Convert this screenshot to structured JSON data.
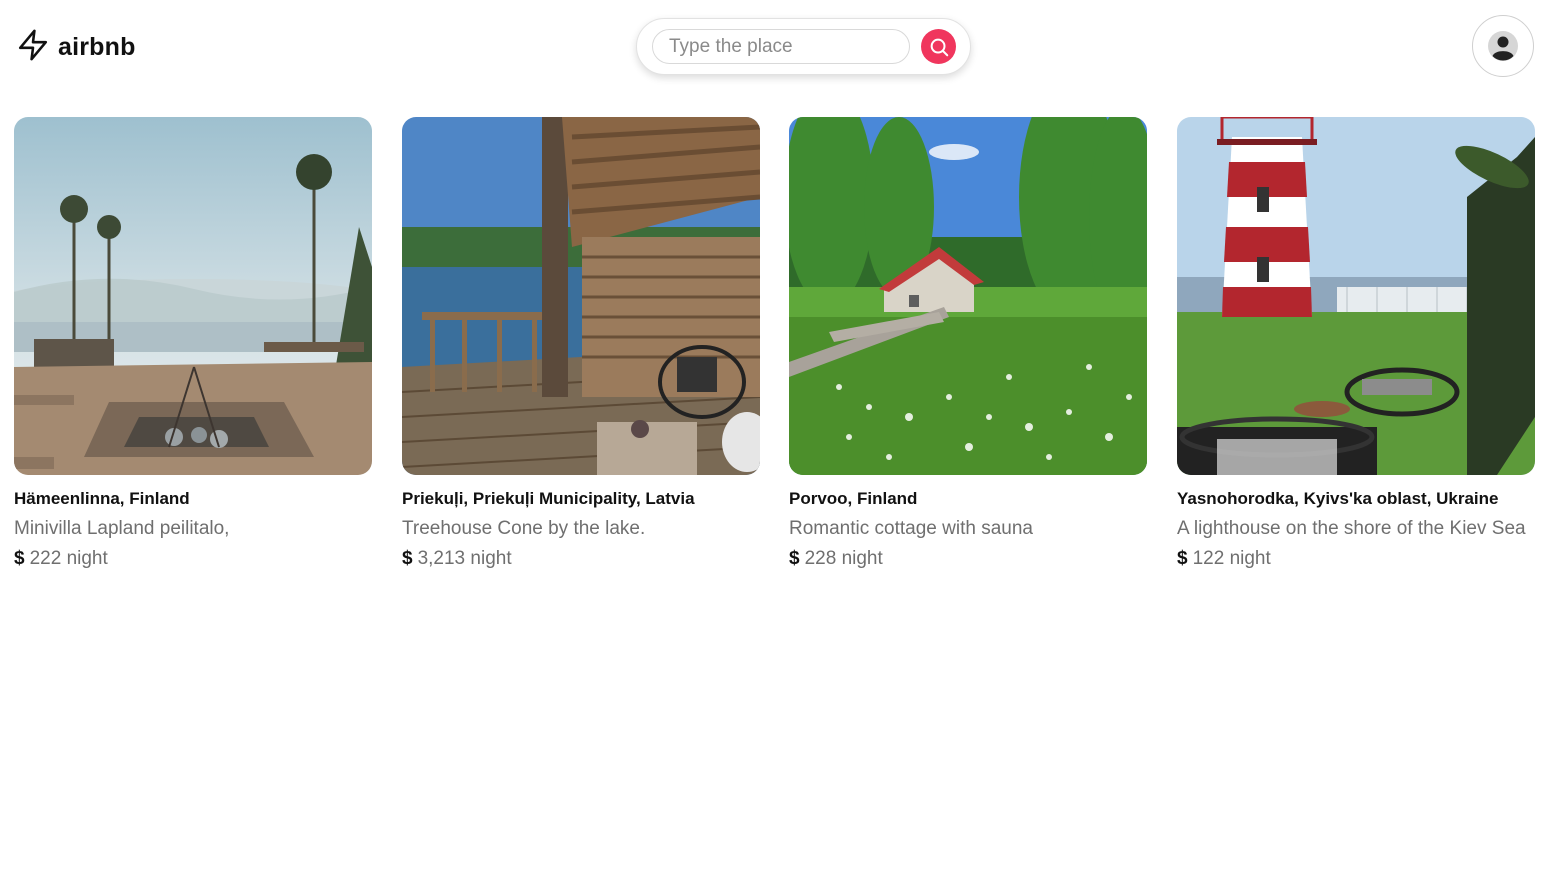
{
  "header": {
    "logo_text": "airbnb",
    "search": {
      "placeholder": "Type the place",
      "value": ""
    }
  },
  "listings": [
    {
      "location": "Hämeenlinna, Finland",
      "description": "Minivilla Lapland peilitalo,",
      "currency": "$",
      "price": "222",
      "unit": "night",
      "image": "lake-deck-firepit"
    },
    {
      "location": "Priekuļi, Priekuļi Municipality, Latvia",
      "description": "Treehouse Cone by the lake.",
      "currency": "$",
      "price": "3,213",
      "unit": "night",
      "image": "treehouse-terrace-lake"
    },
    {
      "location": "Porvoo, Finland",
      "description": "Romantic cottage with sauna",
      "currency": "$",
      "price": "228",
      "unit": "night",
      "image": "red-roof-cottage-meadow"
    },
    {
      "location": "Yasnohorodka, Kyivs'ka oblast, Ukraine",
      "description": "A lighthouse on the shore of the Kiev Sea",
      "currency": "$",
      "price": "122",
      "unit": "night",
      "image": "red-white-lighthouse"
    }
  ],
  "colors": {
    "accent": "#f0365d",
    "title_text": "#111111",
    "muted_text": "#6f6f6f"
  }
}
